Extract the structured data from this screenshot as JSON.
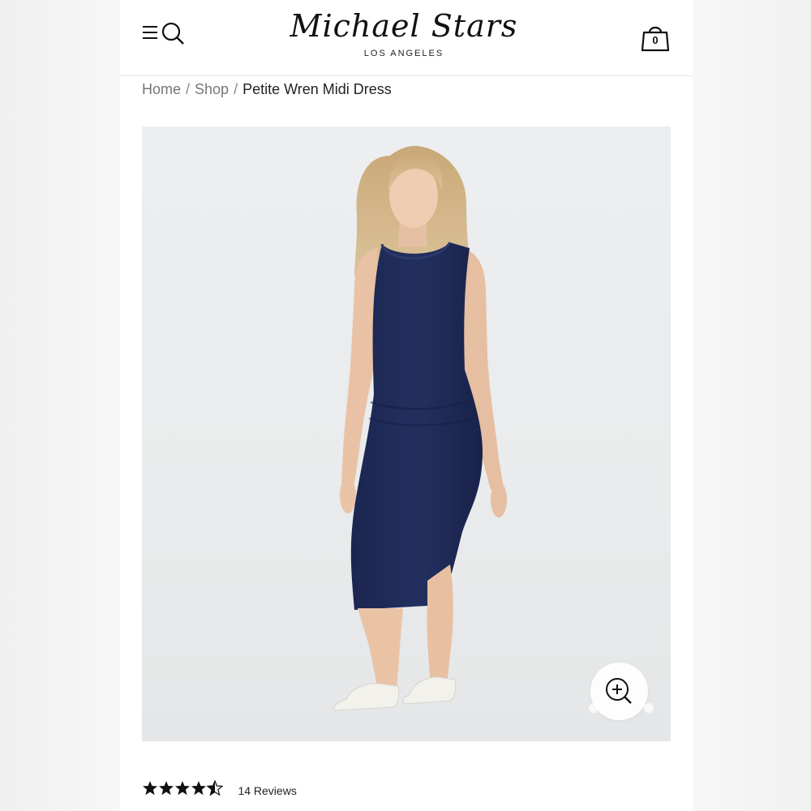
{
  "brand": {
    "name": "Michael Stars",
    "location": "LOS ANGELES"
  },
  "header": {
    "menu_icon": "hamburger-icon",
    "search_icon": "search-icon",
    "cart_icon": "shopping-bag-icon",
    "cart_count": "0"
  },
  "breadcrumb": {
    "items": [
      "Home",
      "Shop"
    ],
    "separator": "/",
    "current": "Petite Wren Midi Dress"
  },
  "gallery": {
    "zoom_icon": "zoom-in-icon",
    "slide_count": 3,
    "active_slide": 2
  },
  "rating": {
    "value": 4.5,
    "max": 5,
    "reviews_label": "14 Reviews"
  },
  "colors": {
    "dress": "#1e2a52",
    "background": "#e9ebec",
    "text": "#222222"
  }
}
